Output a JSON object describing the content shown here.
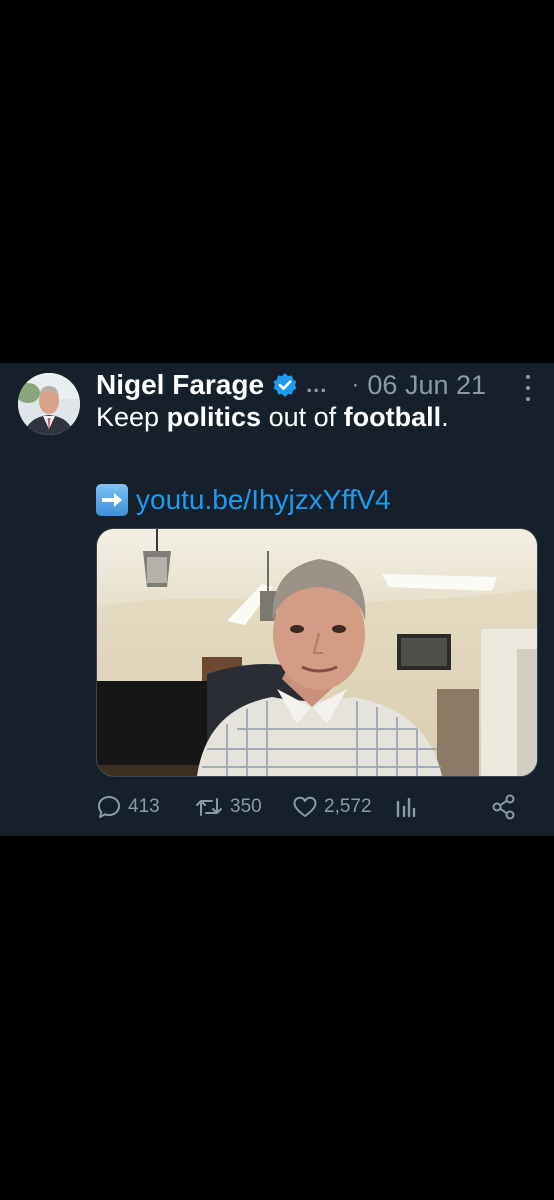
{
  "tweet": {
    "author_name": "Nigel Farage",
    "truncated": "...",
    "separator": "·",
    "date": "06 Jun 21",
    "text_parts": [
      "Keep ",
      "politics",
      " out of ",
      "football",
      "."
    ],
    "link_text": "youtu.be/IhyjzxYffV4",
    "replies": "413",
    "retweets": "350",
    "likes": "2,572"
  },
  "icons": {
    "verified": "verified-badge-icon",
    "more": "more-options-icon",
    "arrow": "right-arrow-emoji",
    "reply": "reply-icon",
    "retweet": "retweet-icon",
    "like": "heart-icon",
    "views": "analytics-icon",
    "share": "share-icon"
  },
  "colors": {
    "background": "#000000",
    "card": "#15202b",
    "accent": "#1d9bf0",
    "muted": "#8b98a5",
    "text": "#ffffff"
  }
}
